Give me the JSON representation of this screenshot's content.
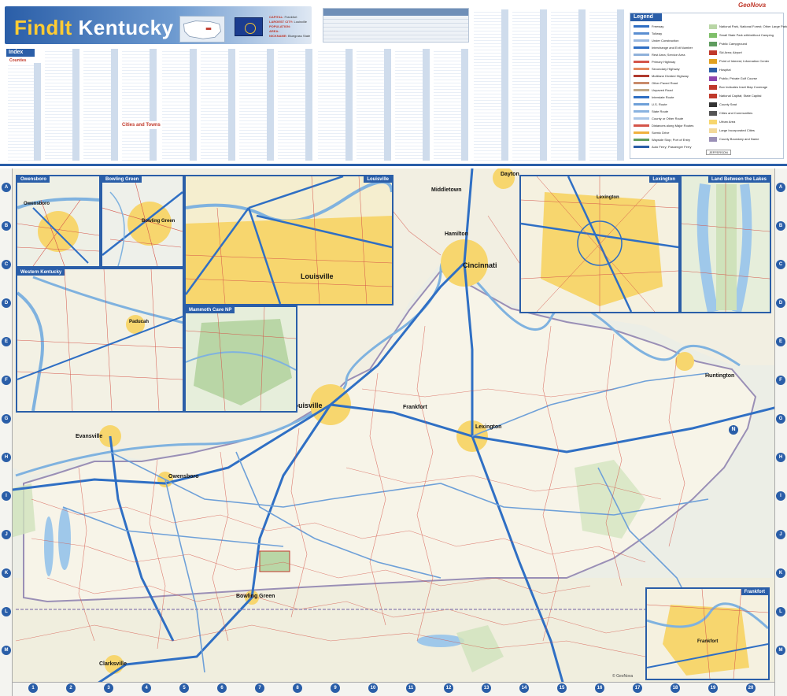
{
  "header": {
    "brand_prefix": "FindIt",
    "brand_state": "Kentucky",
    "publisher": "GeoNova",
    "facts": {
      "capital_key": "CAPITAL:",
      "capital": "Frankfort",
      "largest_key": "LARGEST CITY:",
      "largest": "Louisville",
      "population_key": "POPULATION:",
      "area_key": "AREA:",
      "nickname_key": "NICKNAME:",
      "nickname": "Bluegrass State"
    }
  },
  "index": {
    "title": "Index",
    "counties_title": "Counties",
    "cities_title": "Cities and Towns"
  },
  "legend": {
    "title": "Legend",
    "items_left": [
      "Freeway",
      "Tollway",
      "Under Construction",
      "Interchange and Exit Number",
      "Rest Area; Service Area",
      "Primary Highway",
      "Secondary Highway",
      "Multilane Divided Highway",
      "Other Paved Road",
      "Unpaved Road",
      "Interstate Route",
      "U.S. Route",
      "State Route",
      "County or Other Route",
      "Distances along Major Routes",
      "Scenic Drive",
      "Wayside Stop; Port of Entry",
      "Auto Ferry; Passenger Ferry"
    ],
    "items_right": [
      "National Park, National Forest; Other Large Park",
      "Small State Park with/without Camping",
      "Public Campground",
      "Ski Area; Airport",
      "Point of Interest; Information Center",
      "Hospital",
      "Public; Private Golf Course",
      "Box Indicates Inset Map Coverage",
      "National Capital; State Capital",
      "County Seat",
      "Cities and Communities",
      "Urban Area",
      "Large Incorporated Cities",
      "County Boundary and Name"
    ],
    "county_sample": "JEFFERSON"
  },
  "insets": {
    "owensboro": "Owensboro",
    "bowling_green": "Bowling Green",
    "louisville": "Louisville",
    "western_kentucky": "Western Kentucky",
    "mammoth_cave": "Mammoth Cave NP",
    "lexington": "Lexington",
    "land_between_lakes": "Land Between the Lakes",
    "frankfort": "Frankfort"
  },
  "map_labels": {
    "cincinnati": "Cincinnati",
    "dayton": "Dayton",
    "louisville": "Louisville",
    "lexington": "Lexington",
    "evansville": "Evansville",
    "owensboro": "Owensboro",
    "clarksville": "Clarksville",
    "bowling_green": "Bowling Green",
    "paducah": "Paducah",
    "frankfort": "Frankfort",
    "middletown": "Middletown",
    "hamilton": "Hamilton",
    "huntington": "Huntington",
    "inset_louisville": "Louisville",
    "inset_lexington": "Lexington",
    "inset_frankfort": "Frankfort",
    "inset_owensboro": "Owensboro",
    "inset_bowling_green": "Bowling Green",
    "inset_paducah": "Paducah"
  },
  "grid": {
    "rows": [
      "A",
      "B",
      "C",
      "D",
      "E",
      "F",
      "G",
      "H",
      "I",
      "J",
      "K",
      "L",
      "M"
    ],
    "cols": [
      "1",
      "2",
      "3",
      "4",
      "5",
      "6",
      "7",
      "8",
      "9",
      "10",
      "11",
      "12",
      "13",
      "14",
      "15",
      "16",
      "17",
      "18",
      "19",
      "20"
    ]
  },
  "copyright": "© GeoNova"
}
